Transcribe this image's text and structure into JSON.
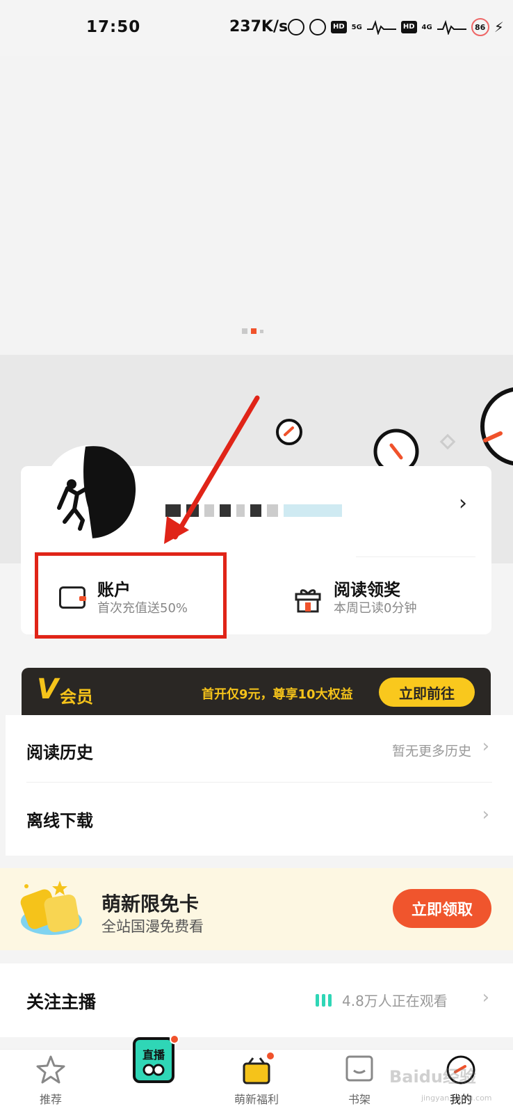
{
  "status_bar": {
    "time": "17:50",
    "speed": "237K/s",
    "hd": "HD",
    "sig1": "5G",
    "sig2": "4G",
    "battery": "86"
  },
  "profile": {
    "account_title": "账户",
    "account_subtitle": "首次充值送50%",
    "reading_title": "阅读领奖",
    "reading_subtitle": "本周已读0分钟"
  },
  "vip": {
    "v_letter": "V",
    "label": "会员",
    "promo": "首开仅9元，尊享10大权益",
    "button": "立即前往"
  },
  "list": {
    "history_title": "阅读历史",
    "history_right": "暂无更多历史",
    "offline_title": "离线下载"
  },
  "promo": {
    "title": "萌新限免卡",
    "subtitle": "全站国漫免费看",
    "button": "立即领取"
  },
  "follow": {
    "title": "关注主播",
    "watching": "4.8万人正在观看"
  },
  "nav": {
    "items": [
      {
        "label": "推荐"
      },
      {
        "label": "直播"
      },
      {
        "label": "萌新福利"
      },
      {
        "label": "书架"
      },
      {
        "label": "我的"
      }
    ]
  },
  "watermark": {
    "text": "Baidu经验",
    "sub": "jingyan.baidu.com"
  },
  "colors": {
    "accent": "#f0522b",
    "vip_gold": "#f5c31a",
    "highlight_red": "#e02418",
    "teal": "#2fd6b6"
  }
}
